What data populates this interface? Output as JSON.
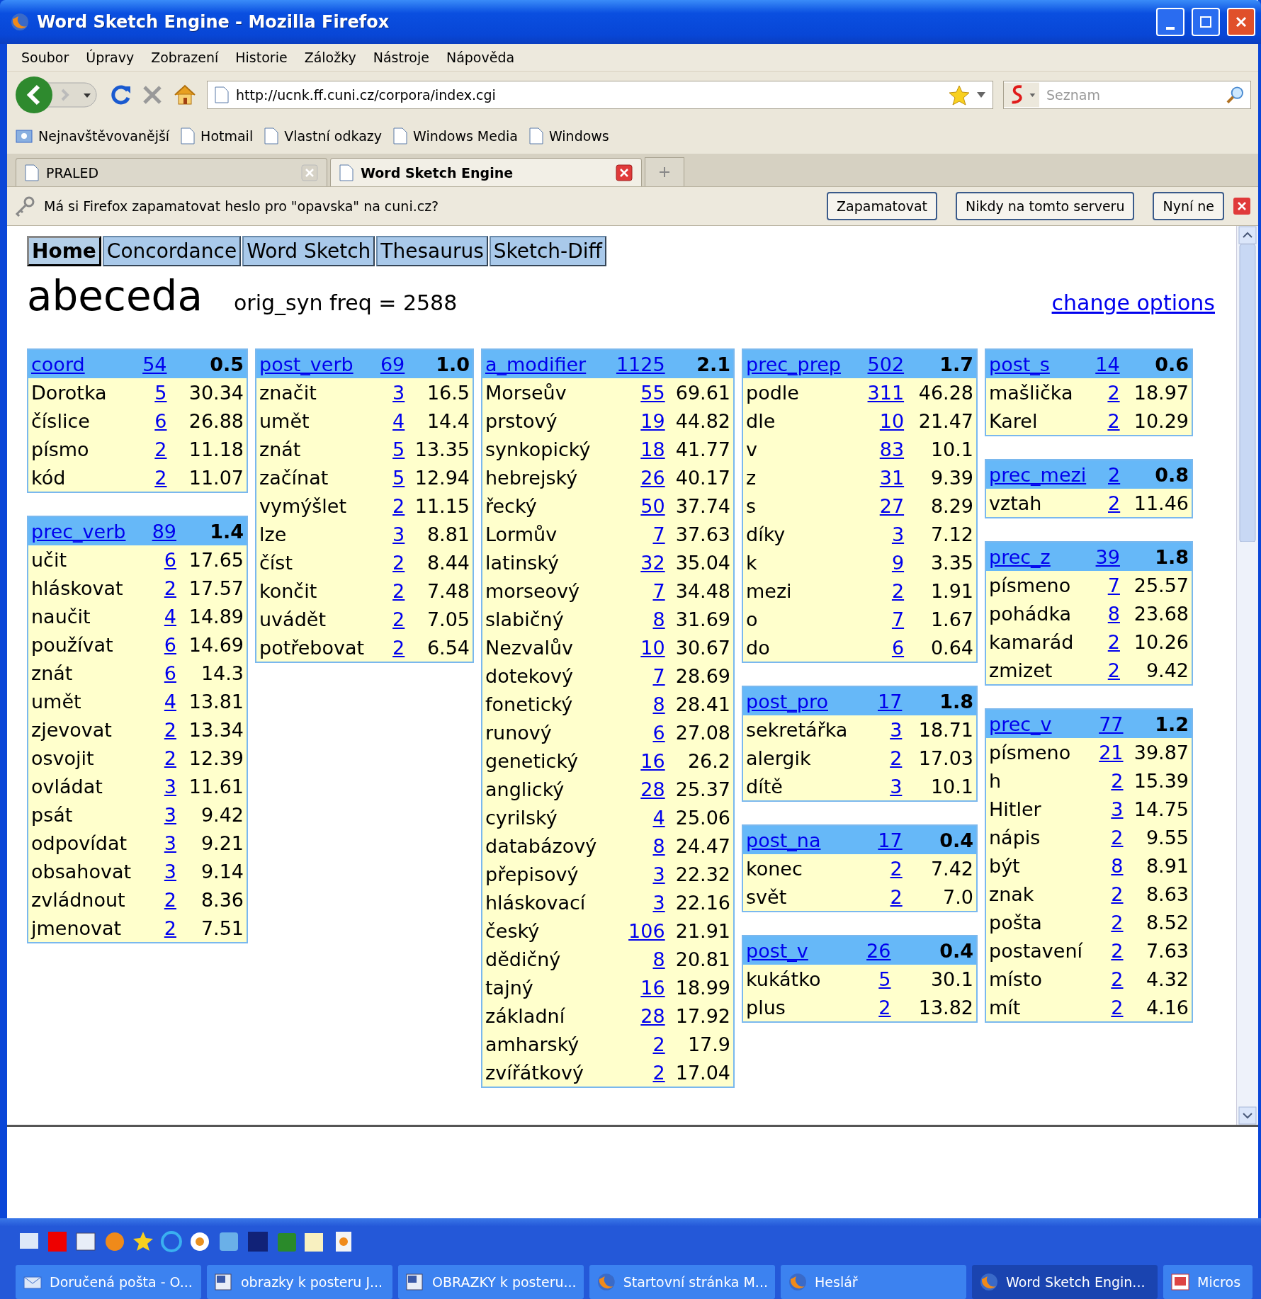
{
  "window": {
    "title": "Word Sketch Engine - Mozilla Firefox"
  },
  "menu": [
    "Soubor",
    "Úpravy",
    "Zobrazení",
    "Historie",
    "Záložky",
    "Nástroje",
    "Nápověda"
  ],
  "address": {
    "url": "http://ucnk.ff.cuni.cz/corpora/index.cgi"
  },
  "search": {
    "placeholder": "Seznam"
  },
  "bookmarks": [
    "Nejnavštěvovanější",
    "Hotmail",
    "Vlastní odkazy",
    "Windows Media",
    "Windows"
  ],
  "browser_tabs": [
    {
      "label": "PRALED",
      "selected": false
    },
    {
      "label": "Word Sketch Engine",
      "selected": true
    }
  ],
  "notification": {
    "message": "Má si Firefox zapamatovat heslo pro \"opavska\" na cuni.cz?",
    "buttons": [
      "Zapamatovat",
      "Nikdy na tomto serveru",
      "Nyní ne"
    ]
  },
  "page": {
    "nav": [
      {
        "label": "Home",
        "selected": true
      },
      {
        "label": "Concordance",
        "selected": false
      },
      {
        "label": "Word Sketch",
        "selected": false
      },
      {
        "label": "Thesaurus",
        "selected": false
      },
      {
        "label": "Sketch-Diff",
        "selected": false
      }
    ],
    "headword": "abeceda",
    "freq": "orig_syn freq = 2588",
    "options_link": "change options",
    "columns": [
      {
        "tables": [
          {
            "relation": "coord",
            "freq": "54",
            "score": "0.5",
            "rows": [
              [
                "Dorotka",
                "5",
                "30.34"
              ],
              [
                "číslice",
                "6",
                "26.88"
              ],
              [
                "písmo",
                "2",
                "11.18"
              ],
              [
                "kód",
                "2",
                "11.07"
              ]
            ]
          },
          {
            "relation": "prec_verb",
            "freq": "89",
            "score": "1.4",
            "rows": [
              [
                "učit",
                "6",
                "17.65"
              ],
              [
                "hláskovat",
                "2",
                "17.57"
              ],
              [
                "naučit",
                "4",
                "14.89"
              ],
              [
                "používat",
                "6",
                "14.69"
              ],
              [
                "znát",
                "6",
                "14.3"
              ],
              [
                "umět",
                "4",
                "13.81"
              ],
              [
                "zjevovat",
                "2",
                "13.34"
              ],
              [
                "osvojit",
                "2",
                "12.39"
              ],
              [
                "ovládat",
                "3",
                "11.61"
              ],
              [
                "psát",
                "3",
                "9.42"
              ],
              [
                "odpovídat",
                "3",
                "9.21"
              ],
              [
                "obsahovat",
                "3",
                "9.14"
              ],
              [
                "zvládnout",
                "2",
                "8.36"
              ],
              [
                "jmenovat",
                "2",
                "7.51"
              ]
            ]
          }
        ]
      },
      {
        "tables": [
          {
            "relation": "post_verb",
            "freq": "69",
            "score": "1.0",
            "rows": [
              [
                "značit",
                "3",
                "16.5"
              ],
              [
                "umět",
                "4",
                "14.4"
              ],
              [
                "znát",
                "5",
                "13.35"
              ],
              [
                "začínat",
                "5",
                "12.94"
              ],
              [
                "vymýšlet",
                "2",
                "11.15"
              ],
              [
                "lze",
                "3",
                "8.81"
              ],
              [
                "číst",
                "2",
                "8.44"
              ],
              [
                "končit",
                "2",
                "7.48"
              ],
              [
                "uvádět",
                "2",
                "7.05"
              ],
              [
                "potřebovat",
                "2",
                "6.54"
              ]
            ]
          }
        ]
      },
      {
        "tables": [
          {
            "relation": "a_modifier",
            "freq": "1125",
            "score": "2.1",
            "rows": [
              [
                "Morseův",
                "55",
                "69.61"
              ],
              [
                "prstový",
                "19",
                "44.82"
              ],
              [
                "synkopický",
                "18",
                "41.77"
              ],
              [
                "hebrejský",
                "26",
                "40.17"
              ],
              [
                "řecký",
                "50",
                "37.74"
              ],
              [
                "Lormův",
                "7",
                "37.63"
              ],
              [
                "latinský",
                "32",
                "35.04"
              ],
              [
                "morseový",
                "7",
                "34.48"
              ],
              [
                "slabičný",
                "8",
                "31.69"
              ],
              [
                "Nezvalův",
                "10",
                "30.67"
              ],
              [
                "dotekový",
                "7",
                "28.69"
              ],
              [
                "fonetický",
                "8",
                "28.41"
              ],
              [
                "runový",
                "6",
                "27.08"
              ],
              [
                "genetický",
                "16",
                "26.2"
              ],
              [
                "anglický",
                "28",
                "25.37"
              ],
              [
                "cyrilský",
                "4",
                "25.06"
              ],
              [
                "databázový",
                "8",
                "24.47"
              ],
              [
                "přepisový",
                "3",
                "22.32"
              ],
              [
                "hláskovací",
                "3",
                "22.16"
              ],
              [
                "český",
                "106",
                "21.91"
              ],
              [
                "dědičný",
                "8",
                "20.81"
              ],
              [
                "tajný",
                "16",
                "18.99"
              ],
              [
                "základní",
                "28",
                "17.92"
              ],
              [
                "amharský",
                "2",
                "17.9"
              ],
              [
                "zvířátkový",
                "2",
                "17.04"
              ]
            ]
          }
        ]
      },
      {
        "tables": [
          {
            "relation": "prec_prep",
            "freq": "502",
            "score": "1.7",
            "rows": [
              [
                "podle",
                "311",
                "46.28"
              ],
              [
                "dle",
                "10",
                "21.47"
              ],
              [
                "v",
                "83",
                "10.1"
              ],
              [
                "z",
                "31",
                "9.39"
              ],
              [
                "s",
                "27",
                "8.29"
              ],
              [
                "díky",
                "3",
                "7.12"
              ],
              [
                "k",
                "9",
                "3.35"
              ],
              [
                "mezi",
                "2",
                "1.91"
              ],
              [
                "o",
                "7",
                "1.67"
              ],
              [
                "do",
                "6",
                "0.64"
              ]
            ]
          },
          {
            "relation": "post_pro",
            "freq": "17",
            "score": "1.8",
            "rows": [
              [
                "sekretářka",
                "3",
                "18.71"
              ],
              [
                "alergik",
                "2",
                "17.03"
              ],
              [
                "dítě",
                "3",
                "10.1"
              ]
            ]
          },
          {
            "relation": "post_na",
            "freq": "17",
            "score": "0.4",
            "rows": [
              [
                "konec",
                "2",
                "7.42"
              ],
              [
                "svět",
                "2",
                "7.0"
              ]
            ]
          },
          {
            "relation": "post_v",
            "freq": "26",
            "score": "0.4",
            "rows": [
              [
                "kukátko",
                "5",
                "30.1"
              ],
              [
                "plus",
                "2",
                "13.82"
              ]
            ]
          }
        ]
      },
      {
        "tables": [
          {
            "relation": "post_s",
            "freq": "14",
            "score": "0.6",
            "rows": [
              [
                "mašlička",
                "2",
                "18.97"
              ],
              [
                "Karel",
                "2",
                "10.29"
              ]
            ]
          },
          {
            "relation": "prec_mezi",
            "freq": "2",
            "score": "0.8",
            "rows": [
              [
                "vztah",
                "2",
                "11.46"
              ]
            ]
          },
          {
            "relation": "prec_z",
            "freq": "39",
            "score": "1.8",
            "rows": [
              [
                "písmeno",
                "7",
                "25.57"
              ],
              [
                "pohádka",
                "8",
                "23.68"
              ],
              [
                "kamarád",
                "2",
                "10.26"
              ],
              [
                "zmizet",
                "2",
                "9.42"
              ]
            ]
          },
          {
            "relation": "prec_v",
            "freq": "77",
            "score": "1.2",
            "rows": [
              [
                "písmeno",
                "21",
                "39.87"
              ],
              [
                "h",
                "2",
                "15.39"
              ],
              [
                "Hitler",
                "3",
                "14.75"
              ],
              [
                "nápis",
                "2",
                "9.55"
              ],
              [
                "být",
                "8",
                "8.91"
              ],
              [
                "znak",
                "2",
                "8.63"
              ],
              [
                "pošta",
                "2",
                "8.52"
              ],
              [
                "postavení",
                "2",
                "7.63"
              ],
              [
                "místo",
                "2",
                "4.32"
              ],
              [
                "mít",
                "2",
                "4.16"
              ]
            ]
          }
        ]
      }
    ]
  },
  "taskbar": {
    "tasks": [
      {
        "label": "Doručená pošta - O...",
        "kind": "mail",
        "selected": false
      },
      {
        "label": "obrazky k posteru J...",
        "kind": "word",
        "selected": false
      },
      {
        "label": "OBRAZKY k posteru...",
        "kind": "word",
        "selected": false
      },
      {
        "label": "Startovní stránka M...",
        "kind": "firefox",
        "selected": false
      },
      {
        "label": "Heslář",
        "kind": "firefox",
        "selected": false
      },
      {
        "label": "Word Sketch Engin...",
        "kind": "firefox",
        "selected": true
      },
      {
        "label": "Micros",
        "kind": "slides",
        "selected": false
      }
    ]
  }
}
